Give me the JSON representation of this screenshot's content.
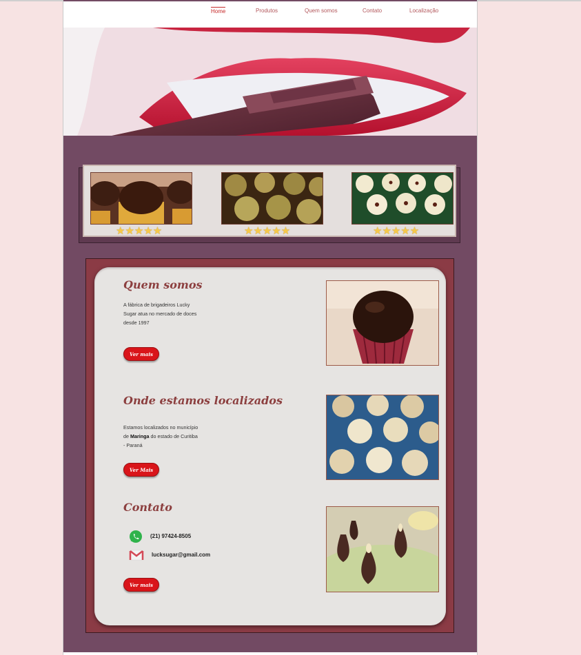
{
  "nav": {
    "items": [
      {
        "label": "Home",
        "active": true
      },
      {
        "label": "Produtos",
        "active": false
      },
      {
        "label": "Quem somos",
        "active": false
      },
      {
        "label": "Contato",
        "active": false
      },
      {
        "label": "Localização",
        "active": false
      }
    ]
  },
  "hero": {
    "image": "lips-biting-chocolate-bar"
  },
  "gallery": {
    "items": [
      {
        "image": "brigadeiro-chocolate-sprinkles",
        "stars": "★★★★★"
      },
      {
        "image": "brigadeiro-pistachio-crusted",
        "stars": "★★★★★"
      },
      {
        "image": "beijinho-white-candies-green-cups",
        "stars": "★★★★★"
      }
    ]
  },
  "sections": {
    "about": {
      "title": "Quem somos",
      "text": "A fábrica de brigadeiros Lucky Sugar atua no mercado de doces desde 1997",
      "button": "Ver mais",
      "image": "brigadeiro-red-cup"
    },
    "location": {
      "title": "Onde estamos localizados",
      "text_before": "Estamos localizados no município de ",
      "text_bold": "Maringa",
      "text_after": " do estado de Curitiba - Paraná",
      "button": "Ver Mais",
      "image": "white-truffles-blue-tray"
    },
    "contact": {
      "title": "Contato",
      "phone": "(21) 97424-8505",
      "email": "lucksugar@gmail.com",
      "button": "Ver mais",
      "image": "chocolate-pear-sweets",
      "phone_icon": "whatsapp-icon",
      "email_icon": "gmail-icon"
    }
  },
  "colors": {
    "page_bg": "#f7e3e3",
    "content_bg": "#724a63",
    "accent_red": "#d9151a",
    "title_color": "#8c3f3f"
  }
}
